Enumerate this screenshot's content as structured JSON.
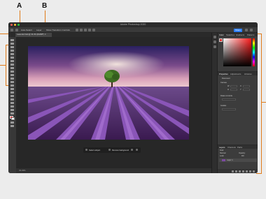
{
  "callouts": {
    "a": "A",
    "b": "B"
  },
  "colors": {
    "leader": "#e07b1a",
    "accent": "#2d7ef7"
  },
  "app": {
    "window_title": "Adobe Photoshop 2020",
    "share_label": "Share",
    "document_tab": "Lavender field @ 33.3% (RGB/8*) ✕",
    "status": "33.33%"
  },
  "options_bar": {
    "items": [
      "Auto-Select:",
      "Layer",
      "Show Transform Controls"
    ]
  },
  "contextual_task_bar": {
    "items": [
      "Select subject",
      "Remove background"
    ]
  },
  "panels": {
    "top_tabs": [
      "Color",
      "Swatches",
      "Gradients",
      "Patterns"
    ],
    "mid_tabs": [
      "Properties",
      "Adjustments",
      "Libraries"
    ],
    "properties": {
      "title": "Document",
      "canvas_label": "Canvas",
      "w_label": "W",
      "h_label": "H",
      "x_label": "X",
      "y_label": "Y",
      "rulers_label": "Rulers & Grids",
      "guides_label": "Guides"
    },
    "layer_tabs": [
      "Layers",
      "Channels",
      "Paths"
    ],
    "layers": {
      "kind_label": "Kind",
      "normal_label": "Normal",
      "opacity_label": "Opacity:",
      "lock_label": "Lock:",
      "fill_label": "Fill:",
      "layer_name": "Layer 1"
    }
  }
}
